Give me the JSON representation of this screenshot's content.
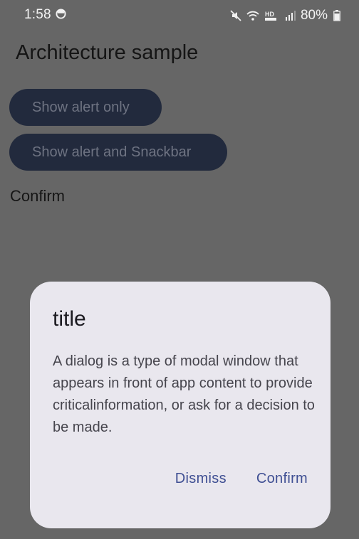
{
  "status_bar": {
    "time": "1:58",
    "battery": "80%",
    "icons": [
      "face-icon",
      "mute-icon",
      "wifi-icon",
      "hd-voice-icon",
      "signal-icon",
      "battery-icon"
    ]
  },
  "app": {
    "title": "Architecture sample",
    "buttons": [
      {
        "label": "Show alert only"
      },
      {
        "label": "Show alert and Snackbar"
      }
    ],
    "result_text": "Confirm"
  },
  "dialog": {
    "title": "title",
    "body": "A dialog is a type of modal window that appears in front of app content to provide criticalinformation, or ask for a decision to be made.",
    "dismiss_label": "Dismiss",
    "confirm_label": "Confirm"
  },
  "colors": {
    "scrim": "#666666",
    "button_bg": "#222a3d",
    "dialog_bg": "#e9e7ee",
    "accent": "#3f4f93"
  }
}
